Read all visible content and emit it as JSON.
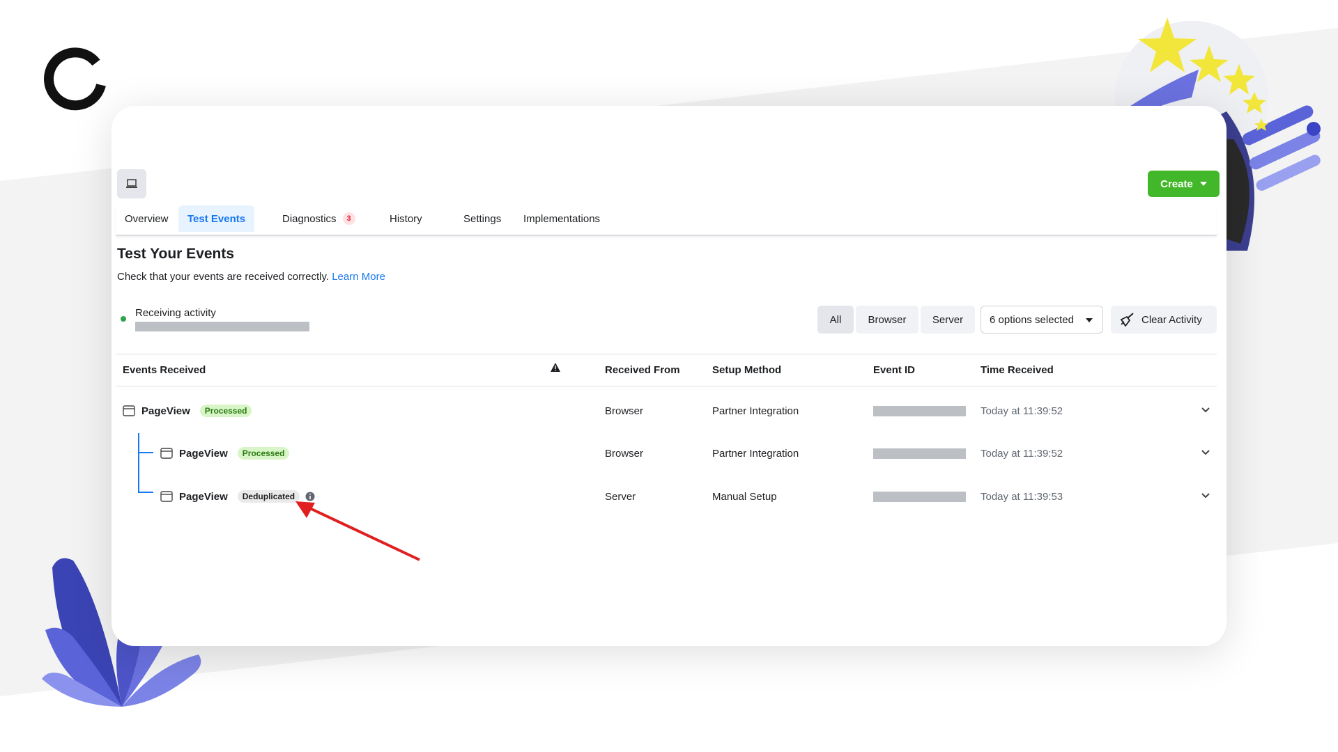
{
  "colors": {
    "accent": "#1877f2",
    "create_button": "#42b72a",
    "status_green": "#31a24c",
    "annotation_arrow": "#e02020"
  },
  "tabs": [
    {
      "label": "Overview",
      "active": false
    },
    {
      "label": "Test Events",
      "active": true
    },
    {
      "label": "Diagnostics",
      "active": false,
      "badge": "3"
    },
    {
      "label": "History",
      "active": false
    },
    {
      "label": "Settings",
      "active": false
    },
    {
      "label": "Implementations",
      "active": false
    }
  ],
  "toolbar": {
    "create_label": "Create",
    "device_icon": "laptop-icon"
  },
  "header": {
    "title": "Test Your Events",
    "description": "Check that your events are received correctly.",
    "learn_more": "Learn More"
  },
  "activity": {
    "status": "Receiving activity"
  },
  "filters": {
    "segments": [
      "All",
      "Browser",
      "Server"
    ],
    "selected_segment": "All",
    "dropdown_value": "6 options selected",
    "clear_label": "Clear Activity"
  },
  "table": {
    "columns": {
      "events": "Events Received",
      "received_from": "Received From",
      "setup_method": "Setup Method",
      "event_id": "Event ID",
      "time": "Time Received"
    },
    "rows": [
      {
        "event": "PageView",
        "status": "Processed",
        "received_from": "Browser",
        "setup_method": "Partner Integration",
        "time": "Today at 11:39:52"
      },
      {
        "event": "PageView",
        "status": "Processed",
        "received_from": "Browser",
        "setup_method": "Partner Integration",
        "time": "Today at 11:39:52"
      },
      {
        "event": "PageView",
        "status": "Deduplicated",
        "received_from": "Server",
        "setup_method": "Manual Setup",
        "time": "Today at 11:39:53"
      }
    ]
  }
}
